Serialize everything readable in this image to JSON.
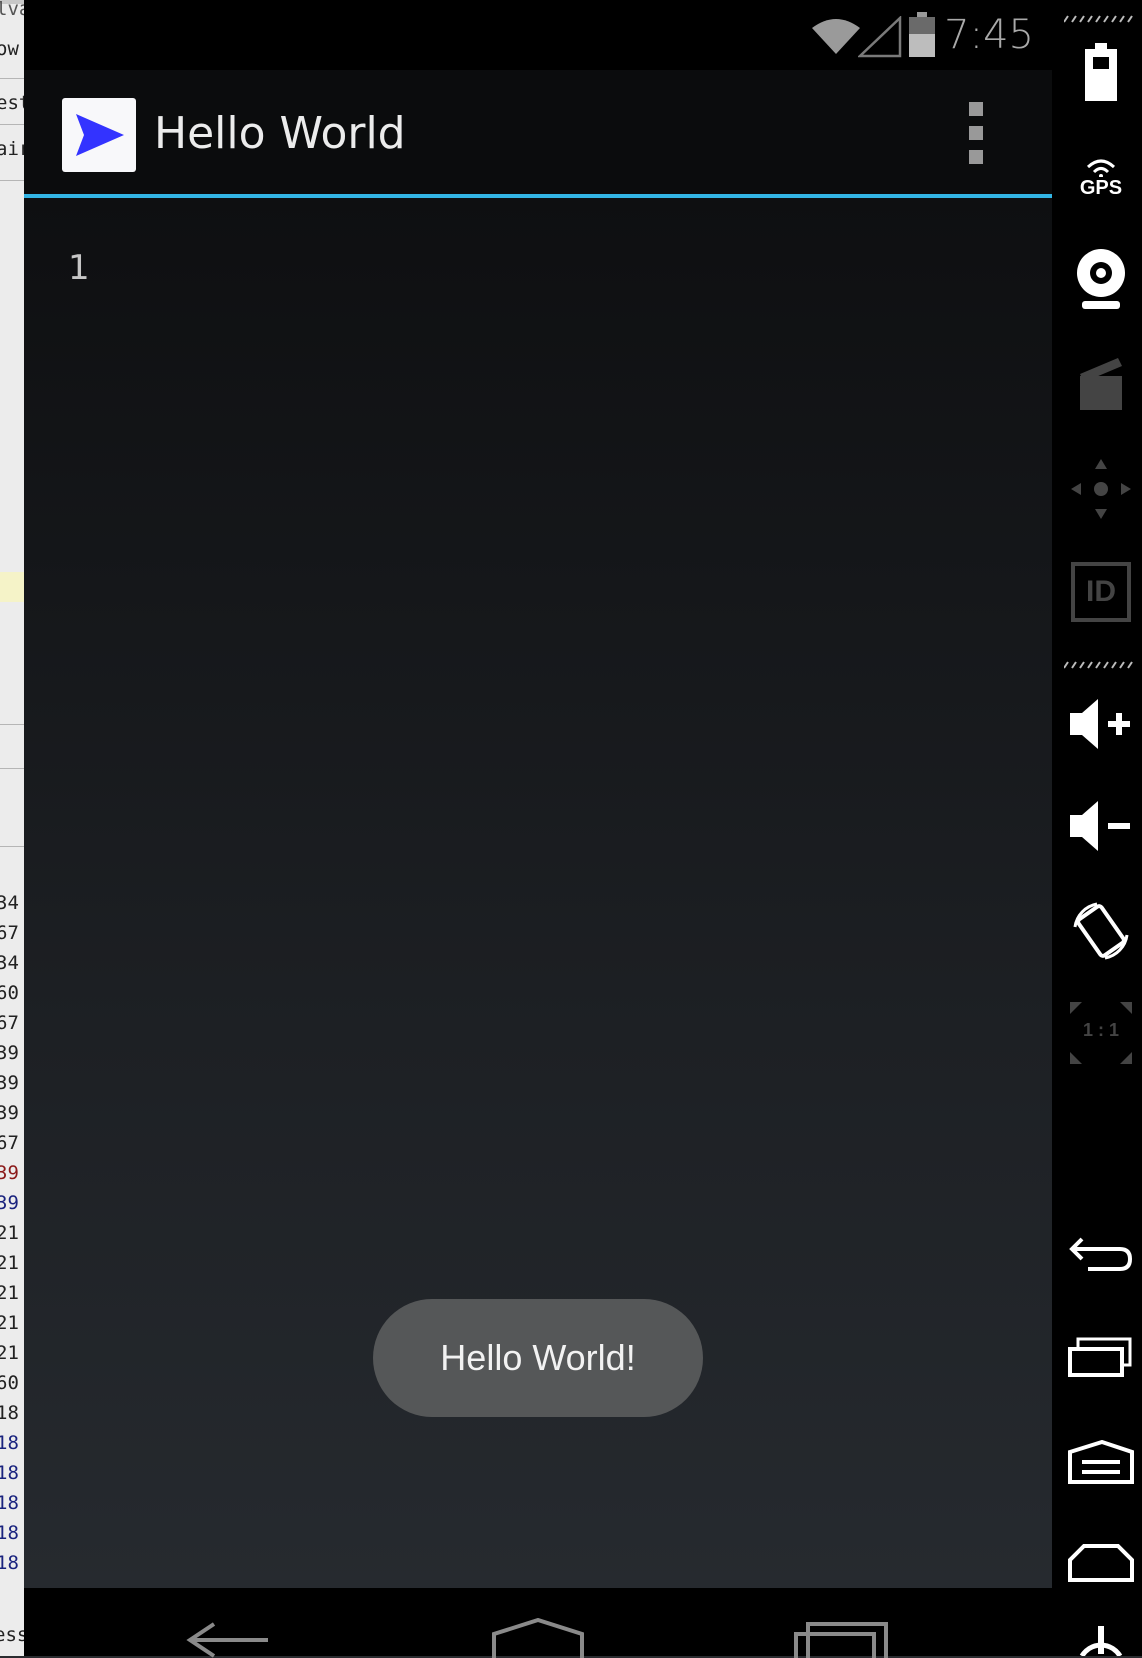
{
  "status_bar": {
    "time": "7:45"
  },
  "app": {
    "title": "Hello World"
  },
  "content": {
    "line_number": "1"
  },
  "toast": {
    "message": "Hello World!"
  },
  "ide_strip": {
    "tabs": [
      "lva",
      "ow",
      "est",
      "air"
    ],
    "numbers": [
      {
        "text": "34",
        "color": "#222222"
      },
      {
        "text": "67",
        "color": "#222222"
      },
      {
        "text": "34",
        "color": "#222222"
      },
      {
        "text": "60",
        "color": "#222222"
      },
      {
        "text": "67",
        "color": "#222222"
      },
      {
        "text": "39",
        "color": "#222222"
      },
      {
        "text": "39",
        "color": "#222222"
      },
      {
        "text": "39",
        "color": "#222222"
      },
      {
        "text": "67",
        "color": "#222222"
      },
      {
        "text": "39",
        "color": "#8b1a1a"
      },
      {
        "text": "39",
        "color": "#1a237e"
      },
      {
        "text": "21",
        "color": "#222222"
      },
      {
        "text": "21",
        "color": "#222222"
      },
      {
        "text": "21",
        "color": "#222222"
      },
      {
        "text": "21",
        "color": "#222222"
      },
      {
        "text": "21",
        "color": "#222222"
      },
      {
        "text": "60",
        "color": "#222222"
      },
      {
        "text": "18",
        "color": "#222222"
      },
      {
        "text": "18",
        "color": "#1a237e"
      },
      {
        "text": "18",
        "color": "#1a237e"
      },
      {
        "text": "18",
        "color": "#1a237e"
      },
      {
        "text": "18",
        "color": "#1a237e"
      },
      {
        "text": "18",
        "color": "#1a237e"
      }
    ],
    "bottom_text": "ess"
  },
  "side_controls": {
    "gps_label": "GPS",
    "id_label": "ID",
    "scale_label": "1 : 1"
  },
  "colors": {
    "accent": "#33b5e5",
    "app_icon_arrow": "#3333ff"
  },
  "icons": [
    "wifi-icon",
    "signal-icon",
    "battery-icon",
    "overflow-menu-icon",
    "back-icon",
    "home-icon",
    "recents-icon"
  ]
}
